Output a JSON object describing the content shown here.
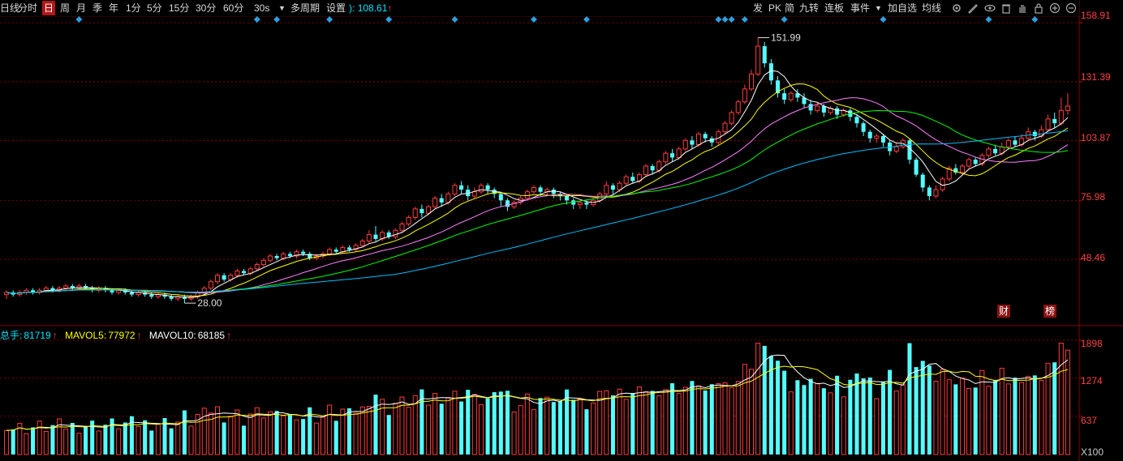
{
  "toolbar": {
    "items": [
      "日线",
      "分时",
      "日",
      "周",
      "月",
      "季",
      "年",
      "1分",
      "5分",
      "15分",
      "30分",
      "60分",
      "30s",
      "多周期",
      "设置"
    ],
    "active": "日",
    "price_prefix": "):",
    "price_value": "108.61",
    "right_items": [
      "发",
      "PK",
      "简",
      "九转",
      "连板",
      "事件",
      "加自选",
      "均线"
    ],
    "right_icons": [
      "settings-icon",
      "draw-icon",
      "eye-icon",
      "delete-icon",
      "hand-icon",
      "lock-icon",
      "zoom-in-icon",
      "zoom-out-icon"
    ]
  },
  "price_axis": {
    "labels": [
      "158.91",
      "131.39",
      "103.87",
      "75.98",
      "48.46"
    ]
  },
  "annotations": {
    "high_label": "151.99",
    "low_label": "28.00",
    "badges": [
      "财",
      "榜"
    ]
  },
  "volume_legend": {
    "total_label": "总手:",
    "total_value": "81719",
    "mavol5_label": "MAVOL5:",
    "mavol5_value": "77972",
    "mavol10_label": "MAVOL10:",
    "mavol10_value": "68185",
    "arrow": "↑"
  },
  "volume_axis": {
    "labels": [
      "1898",
      "1274",
      "637"
    ],
    "unit": "X100"
  },
  "colors": {
    "up": "#ff3b3b",
    "down": "#54ffff",
    "ma5": "#ffffff",
    "ma10": "#ffff00",
    "ma20": "#ff80ff",
    "ma30": "#00ff00",
    "ma60": "#00bfff",
    "grid": "#7a0000",
    "diamond": "#2aa0e0"
  },
  "chart_data": {
    "type": "candlestick",
    "price_range": [
      22,
      162
    ],
    "volume_range": [
      0,
      1898
    ],
    "high": 151.99,
    "low": 28.0,
    "candles": [
      [
        32,
        33,
        30,
        34
      ],
      [
        33,
        32,
        31,
        34
      ],
      [
        32,
        33,
        31,
        34
      ],
      [
        33,
        34,
        32,
        35
      ],
      [
        34,
        33,
        32,
        35
      ],
      [
        33,
        34,
        32,
        35
      ],
      [
        34,
        35,
        33,
        36
      ],
      [
        35,
        34,
        33,
        36
      ],
      [
        34,
        35,
        33,
        36
      ],
      [
        35,
        36,
        34,
        37
      ],
      [
        36,
        35,
        34,
        37
      ],
      [
        35,
        36,
        34,
        37
      ],
      [
        36,
        35,
        34,
        37
      ],
      [
        35,
        34,
        33,
        36
      ],
      [
        34,
        35,
        33,
        36
      ],
      [
        35,
        34,
        33,
        36
      ],
      [
        34,
        33,
        32,
        35
      ],
      [
        33,
        34,
        32,
        35
      ],
      [
        34,
        33,
        32,
        35
      ],
      [
        33,
        32,
        31,
        34
      ],
      [
        32,
        33,
        31,
        34
      ],
      [
        33,
        32,
        31,
        34
      ],
      [
        32,
        31,
        30,
        33
      ],
      [
        31,
        32,
        30,
        33
      ],
      [
        32,
        31,
        30,
        33
      ],
      [
        31,
        30,
        29,
        32
      ],
      [
        30,
        31,
        29,
        32
      ],
      [
        31,
        30,
        28,
        32
      ],
      [
        30,
        31,
        29,
        32
      ],
      [
        31,
        33,
        30,
        34
      ],
      [
        33,
        35,
        32,
        36
      ],
      [
        35,
        38,
        34,
        39
      ],
      [
        38,
        41,
        37,
        42
      ],
      [
        41,
        39,
        38,
        42
      ],
      [
        39,
        41,
        38,
        42
      ],
      [
        41,
        43,
        40,
        44
      ],
      [
        43,
        42,
        41,
        44
      ],
      [
        42,
        44,
        41,
        45
      ],
      [
        44,
        46,
        43,
        47
      ],
      [
        46,
        48,
        45,
        49
      ],
      [
        48,
        50,
        47,
        51
      ],
      [
        50,
        49,
        48,
        51
      ],
      [
        49,
        51,
        48,
        52
      ],
      [
        51,
        50,
        49,
        52
      ],
      [
        50,
        52,
        49,
        53
      ],
      [
        52,
        51,
        50,
        53
      ],
      [
        51,
        49,
        48,
        52
      ],
      [
        49,
        50,
        48,
        51
      ],
      [
        50,
        51,
        49,
        52
      ],
      [
        51,
        53,
        50,
        54
      ],
      [
        53,
        52,
        51,
        54
      ],
      [
        52,
        54,
        51,
        55
      ],
      [
        54,
        53,
        52,
        55
      ],
      [
        53,
        55,
        52,
        56
      ],
      [
        55,
        57,
        54,
        58
      ],
      [
        57,
        60,
        56,
        62
      ],
      [
        60,
        58,
        57,
        64
      ],
      [
        58,
        61,
        57,
        62
      ],
      [
        61,
        59,
        58,
        62
      ],
      [
        59,
        62,
        58,
        63
      ],
      [
        62,
        65,
        61,
        66
      ],
      [
        65,
        68,
        64,
        69
      ],
      [
        68,
        72,
        67,
        73
      ],
      [
        72,
        70,
        68,
        74
      ],
      [
        70,
        73,
        69,
        74
      ],
      [
        73,
        77,
        72,
        78
      ],
      [
        77,
        75,
        73,
        79
      ],
      [
        75,
        79,
        74,
        80
      ],
      [
        79,
        83,
        78,
        84
      ],
      [
        83,
        81,
        79,
        85
      ],
      [
        81,
        78,
        76,
        83
      ],
      [
        78,
        80,
        77,
        82
      ],
      [
        80,
        83,
        79,
        84
      ],
      [
        83,
        81,
        79,
        84
      ],
      [
        81,
        79,
        77,
        82
      ],
      [
        79,
        76,
        73,
        80
      ],
      [
        76,
        73,
        71,
        77
      ],
      [
        73,
        75,
        72,
        76
      ],
      [
        75,
        77,
        74,
        78
      ],
      [
        77,
        80,
        76,
        81
      ],
      [
        80,
        82,
        79,
        83
      ],
      [
        82,
        80,
        78,
        83
      ],
      [
        80,
        81,
        78,
        82
      ],
      [
        81,
        79,
        77,
        82
      ],
      [
        79,
        78,
        76,
        80
      ],
      [
        78,
        76,
        74,
        79
      ],
      [
        76,
        74,
        72,
        77
      ],
      [
        74,
        75,
        72,
        76
      ],
      [
        75,
        74,
        72,
        76
      ],
      [
        74,
        76,
        73,
        77
      ],
      [
        76,
        79,
        75,
        80
      ],
      [
        79,
        83,
        78,
        85
      ],
      [
        83,
        81,
        79,
        84
      ],
      [
        81,
        84,
        80,
        85
      ],
      [
        84,
        87,
        83,
        88
      ],
      [
        87,
        85,
        84,
        89
      ],
      [
        85,
        88,
        84,
        89
      ],
      [
        88,
        92,
        87,
        93
      ],
      [
        92,
        90,
        88,
        93
      ],
      [
        90,
        94,
        89,
        95
      ],
      [
        94,
        98,
        93,
        99
      ],
      [
        98,
        96,
        94,
        100
      ],
      [
        96,
        100,
        95,
        101
      ],
      [
        100,
        104,
        99,
        105
      ],
      [
        104,
        102,
        100,
        106
      ],
      [
        102,
        107,
        101,
        108
      ],
      [
        107,
        105,
        103,
        108
      ],
      [
        105,
        103,
        101,
        106
      ],
      [
        103,
        108,
        102,
        109
      ],
      [
        108,
        112,
        107,
        113
      ],
      [
        112,
        117,
        111,
        118
      ],
      [
        117,
        122,
        116,
        123
      ],
      [
        122,
        128,
        121,
        130
      ],
      [
        128,
        135,
        127,
        137
      ],
      [
        135,
        148,
        134,
        152
      ],
      [
        148,
        140,
        138,
        150
      ],
      [
        140,
        132,
        130,
        142
      ],
      [
        132,
        126,
        124,
        134
      ],
      [
        126,
        123,
        121,
        128
      ],
      [
        123,
        126,
        122,
        127
      ],
      [
        126,
        124,
        122,
        128
      ],
      [
        124,
        121,
        119,
        126
      ],
      [
        121,
        118,
        116,
        123
      ],
      [
        118,
        120,
        117,
        122
      ],
      [
        120,
        117,
        115,
        121
      ],
      [
        117,
        119,
        116,
        120
      ],
      [
        119,
        116,
        114,
        120
      ],
      [
        116,
        118,
        115,
        119
      ],
      [
        118,
        115,
        113,
        119
      ],
      [
        115,
        112,
        110,
        116
      ],
      [
        112,
        108,
        106,
        113
      ],
      [
        108,
        105,
        103,
        109
      ],
      [
        105,
        106,
        103,
        107
      ],
      [
        106,
        103,
        101,
        107
      ],
      [
        103,
        99,
        97,
        104
      ],
      [
        99,
        101,
        98,
        103
      ],
      [
        101,
        104,
        100,
        105
      ],
      [
        104,
        95,
        93,
        105
      ],
      [
        95,
        88,
        87,
        96
      ],
      [
        88,
        82,
        80,
        89
      ],
      [
        82,
        78,
        76,
        83
      ],
      [
        78,
        81,
        77,
        83
      ],
      [
        81,
        86,
        80,
        87
      ],
      [
        86,
        91,
        85,
        92
      ],
      [
        91,
        89,
        88,
        93
      ],
      [
        89,
        92,
        88,
        93
      ],
      [
        92,
        95,
        91,
        96
      ],
      [
        95,
        93,
        92,
        96
      ],
      [
        93,
        97,
        92,
        98
      ],
      [
        97,
        100,
        96,
        101
      ],
      [
        100,
        98,
        97,
        102
      ],
      [
        98,
        101,
        97,
        103
      ],
      [
        101,
        104,
        100,
        105
      ],
      [
        104,
        102,
        101,
        106
      ],
      [
        102,
        105,
        101,
        107
      ],
      [
        105,
        108,
        104,
        110
      ],
      [
        108,
        106,
        104,
        109
      ],
      [
        106,
        109,
        105,
        111
      ],
      [
        109,
        114,
        108,
        116
      ],
      [
        114,
        112,
        110,
        117
      ],
      [
        112,
        118,
        111,
        124
      ],
      [
        118,
        120,
        116,
        126
      ]
    ]
  }
}
